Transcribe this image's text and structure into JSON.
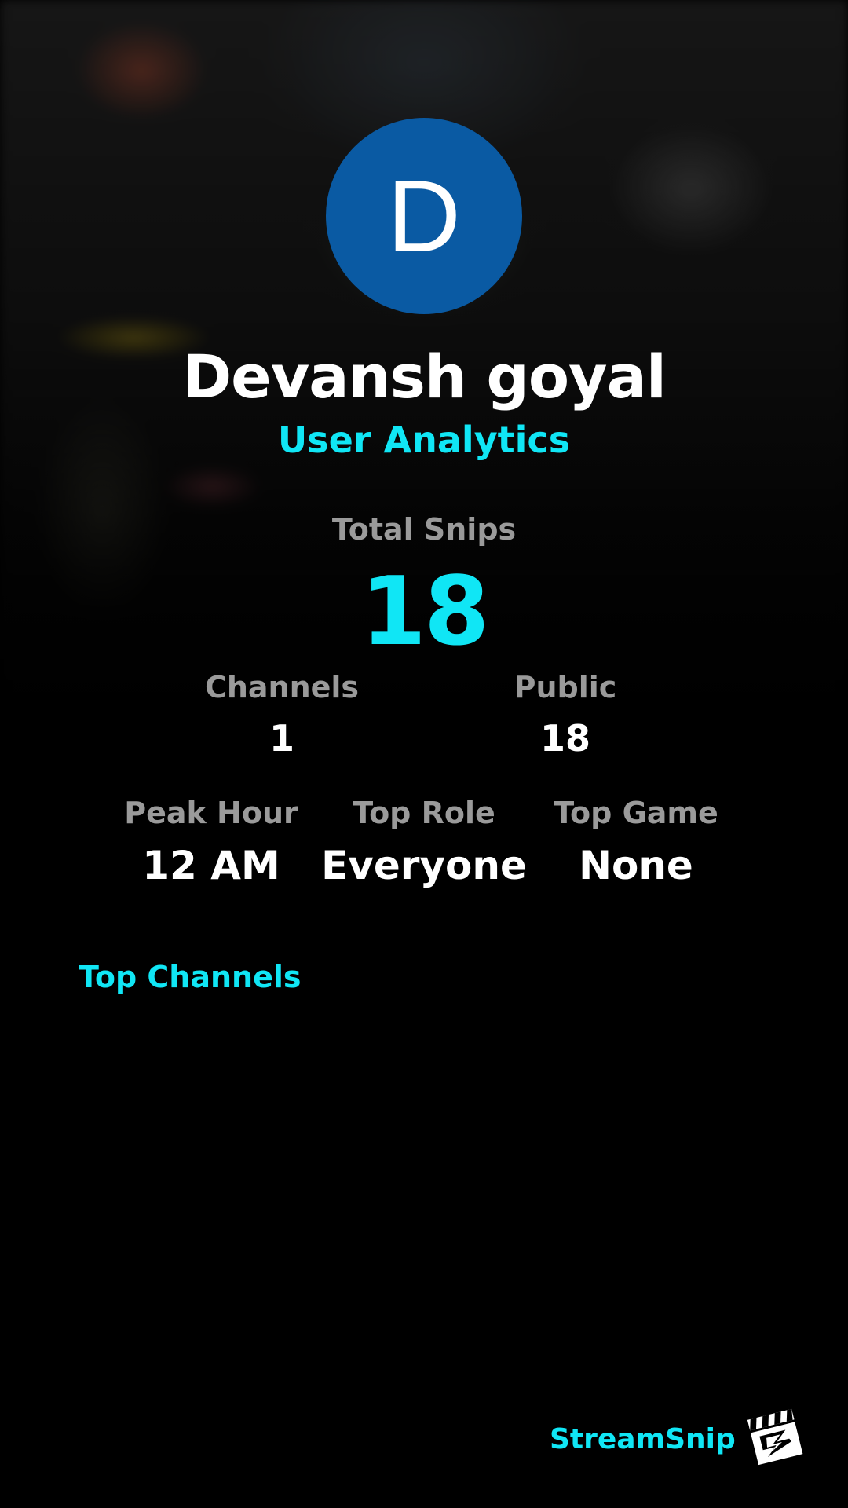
{
  "profile": {
    "avatar_initial": "D",
    "avatar_color": "#0a5aa3",
    "name": "Devansh goyal",
    "subtitle": "User Analytics"
  },
  "stats": {
    "total_snips_label": "Total Snips",
    "total_snips_value": "18",
    "channels_label": "Channels",
    "channels_value": "1",
    "public_label": "Public",
    "public_value": "18",
    "peak_hour_label": "Peak Hour",
    "peak_hour_value": "12 AM",
    "top_role_label": "Top Role",
    "top_role_value": "Everyone",
    "top_game_label": "Top Game",
    "top_game_value": "None"
  },
  "sections": {
    "top_channels_heading": "Top Channels"
  },
  "brand": {
    "name": "StreamSnip",
    "logo_icon": "clapperboard-logo-icon",
    "accent_color": "#10e6f5"
  }
}
